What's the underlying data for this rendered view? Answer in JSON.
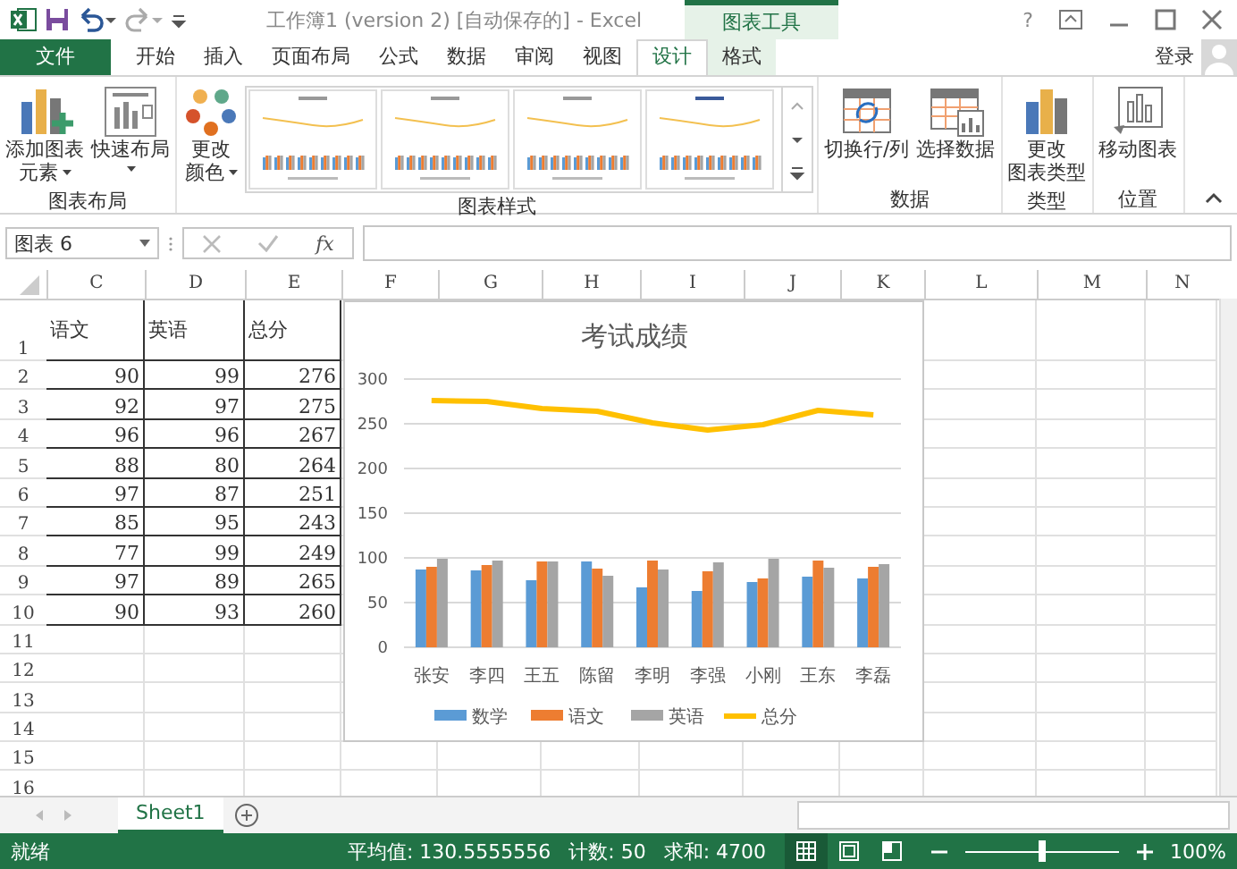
{
  "window": {
    "title": "工作簿1 (version 2) [自动保存的] - Excel",
    "context_tab": "图表工具",
    "help": "?"
  },
  "tabs": [
    {
      "label": "文件",
      "kind": "file",
      "selected": false
    },
    {
      "label": "开始",
      "kind": "plain",
      "selected": false
    },
    {
      "label": "插入",
      "kind": "plain",
      "selected": false
    },
    {
      "label": "页面布局",
      "kind": "plain",
      "selected": false
    },
    {
      "label": "公式",
      "kind": "plain",
      "selected": false
    },
    {
      "label": "数据",
      "kind": "plain",
      "selected": false
    },
    {
      "label": "审阅",
      "kind": "plain",
      "selected": false
    },
    {
      "label": "视图",
      "kind": "plain",
      "selected": false
    },
    {
      "label": "设计",
      "kind": "context",
      "selected": true
    },
    {
      "label": "格式",
      "kind": "context",
      "selected": false
    }
  ],
  "account": {
    "label": "登录"
  },
  "ribbon": [
    {
      "label": "图表布局",
      "buttons": [
        {
          "lines": [
            "添加图表",
            "元素"
          ],
          "dropdown": true
        },
        {
          "lines": [
            "快速布局"
          ],
          "dropdown": true
        }
      ]
    },
    {
      "label": "图表样式",
      "buttons": [
        {
          "lines": [
            "更改",
            "颜色"
          ],
          "dropdown": true
        }
      ],
      "gallery": true
    },
    {
      "label": "数据",
      "buttons": [
        {
          "lines": [
            "切换行/列"
          ],
          "dropdown": false
        },
        {
          "lines": [
            "选择数据"
          ],
          "dropdown": false
        }
      ]
    },
    {
      "label": "类型",
      "buttons": [
        {
          "lines": [
            "更改",
            "图表类型"
          ],
          "dropdown": false
        }
      ]
    },
    {
      "label": "位置",
      "buttons": [
        {
          "lines": [
            "移动图表"
          ],
          "dropdown": false
        }
      ]
    }
  ],
  "formula_bar": {
    "name_box": "图表 6",
    "fx": "fx"
  },
  "sheet": {
    "columns": [
      "C",
      "D",
      "E",
      "F",
      "G",
      "H",
      "I",
      "J",
      "K",
      "L",
      "M",
      "N"
    ],
    "rows": [
      {
        "number": "1",
        "cells": [
          "语文",
          "英语",
          "总分"
        ]
      },
      {
        "number": "2",
        "cells": [
          "90",
          "99",
          "276"
        ]
      },
      {
        "number": "3",
        "cells": [
          "92",
          "97",
          "275"
        ]
      },
      {
        "number": "4",
        "cells": [
          "96",
          "96",
          "267"
        ]
      },
      {
        "number": "5",
        "cells": [
          "88",
          "80",
          "264"
        ]
      },
      {
        "number": "6",
        "cells": [
          "97",
          "87",
          "251"
        ]
      },
      {
        "number": "7",
        "cells": [
          "85",
          "95",
          "243"
        ]
      },
      {
        "number": "8",
        "cells": [
          "77",
          "99",
          "249"
        ]
      },
      {
        "number": "9",
        "cells": [
          "97",
          "89",
          "265"
        ]
      },
      {
        "number": "10",
        "cells": [
          "90",
          "93",
          "260"
        ]
      },
      {
        "number": "11",
        "cells": []
      },
      {
        "number": "12",
        "cells": []
      },
      {
        "number": "13",
        "cells": []
      },
      {
        "number": "14",
        "cells": []
      },
      {
        "number": "15",
        "cells": []
      },
      {
        "number": "16",
        "cells": []
      }
    ]
  },
  "chart": {
    "chart_data": {
      "type": "bar",
      "title": "考试成绩",
      "grid": true,
      "legend": "bottom",
      "categories": [
        "张安",
        "李四",
        "王五",
        "陈留",
        "李明",
        "李强",
        "小刚",
        "王东",
        "李磊"
      ],
      "ylim": [
        0,
        300
      ],
      "yticks": [
        0,
        50,
        100,
        150,
        200,
        250,
        300
      ],
      "series": [
        {
          "name": "数学",
          "color": "#5b9bd5",
          "type": "bar",
          "values": [
            87,
            86,
            75,
            96,
            67,
            63,
            73,
            79,
            77
          ]
        },
        {
          "name": "语文",
          "color": "#ed7d31",
          "type": "bar",
          "values": [
            90,
            92,
            96,
            88,
            97,
            85,
            77,
            97,
            90
          ]
        },
        {
          "name": "英语",
          "color": "#a5a5a5",
          "type": "bar",
          "values": [
            99,
            97,
            96,
            80,
            87,
            95,
            99,
            89,
            93
          ]
        },
        {
          "name": "总分",
          "color": "#ffc000",
          "type": "line",
          "values": [
            276,
            275,
            267,
            264,
            251,
            243,
            249,
            265,
            260
          ]
        }
      ]
    }
  },
  "sheet_tabs": [
    {
      "label": "Sheet1",
      "selected": true
    }
  ],
  "status_bar": {
    "status": "就绪",
    "average": "平均值: 130.5555556",
    "count": "计数: 50",
    "sum": "求和: 4700",
    "views": [
      {
        "selected": true
      },
      {
        "selected": false
      },
      {
        "selected": false
      }
    ],
    "zoom": {
      "level": 0.5,
      "label": "100%"
    }
  }
}
